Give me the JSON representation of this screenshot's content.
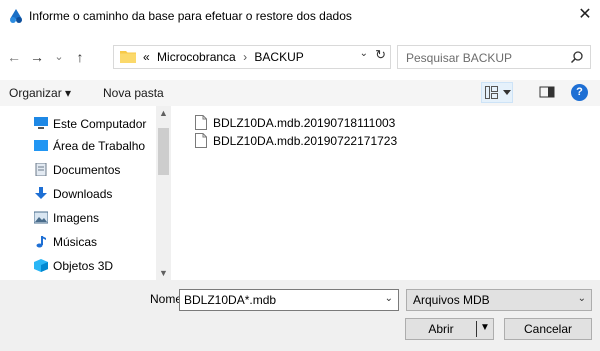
{
  "dialog": {
    "title": "Informe o caminho da base para efetuar o restore dos dados",
    "close_glyph": "✕"
  },
  "nav": {
    "back_glyph": "←",
    "forward_glyph": "→",
    "recent_glyph": "⌄",
    "up_glyph": "↑",
    "overflow": "«",
    "breadcrumbs": [
      "Microcobranca",
      "BACKUP"
    ],
    "separator": "›",
    "dropdown_glyph": "⌄",
    "refresh_glyph": "↻",
    "search_placeholder": "Pesquisar BACKUP"
  },
  "toolbar": {
    "organize_label": "Organizar ▾",
    "new_folder_label": "Nova pasta",
    "help_glyph": "?"
  },
  "sidebar": {
    "items": [
      {
        "label": "Este Computador",
        "icon": "computer-icon"
      },
      {
        "label": "Área de Trabalho",
        "icon": "desktop-icon"
      },
      {
        "label": "Documentos",
        "icon": "documents-icon"
      },
      {
        "label": "Downloads",
        "icon": "downloads-icon"
      },
      {
        "label": "Imagens",
        "icon": "pictures-icon"
      },
      {
        "label": "Músicas",
        "icon": "music-icon"
      },
      {
        "label": "Objetos 3D",
        "icon": "objects-3d-icon"
      }
    ]
  },
  "files": [
    {
      "name": "BDLZ10DA.mdb.20190718111003"
    },
    {
      "name": "BDLZ10DA.mdb.20190722171723"
    }
  ],
  "footer": {
    "name_label": "Nome:",
    "name_value": "BDLZ10DA*.mdb",
    "file_type": "Arquivos MDB",
    "open_label": "Abrir",
    "cancel_label": "Cancelar",
    "dropdown_glyph": "⌄"
  },
  "colors": {
    "accent": "#1e6fd4",
    "folder": "#f7c948",
    "toolbar_bg": "#f5f5f5",
    "footer_bg": "#f0f0f0"
  }
}
